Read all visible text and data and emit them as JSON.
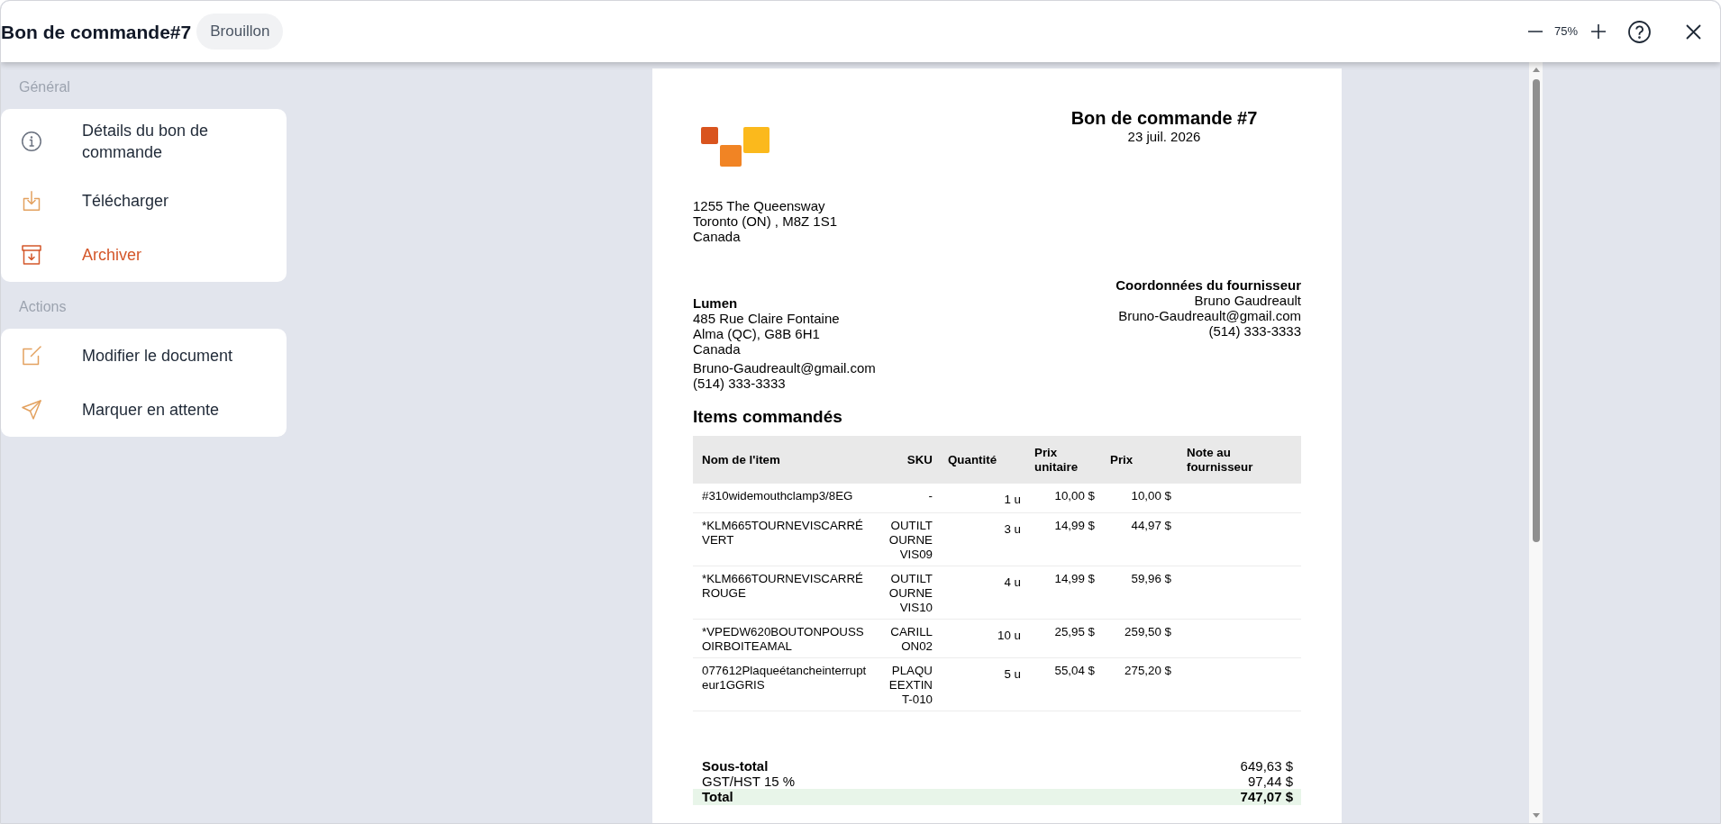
{
  "window": {
    "title": "Bon de commande#7",
    "status_badge": "Brouillon",
    "zoom_level": "75%"
  },
  "sidebar": {
    "sections": [
      {
        "heading": "Général",
        "items": [
          {
            "label": "Détails du bon de commande",
            "kind": "info",
            "danger": false
          },
          {
            "label": "Télécharger",
            "kind": "download",
            "danger": false
          },
          {
            "label": "Archiver",
            "kind": "archive",
            "danger": true
          }
        ]
      },
      {
        "heading": "Actions",
        "items": [
          {
            "label": "Modifier le document",
            "kind": "edit",
            "danger": false
          },
          {
            "label": "Marquer en attente",
            "kind": "send",
            "danger": false
          }
        ]
      }
    ]
  },
  "document": {
    "title": "Bon de commande #7",
    "date": "23 juil. 2026",
    "company_address": [
      "1255 The Queensway",
      "Toronto (ON) , M8Z 1S1",
      "Canada"
    ],
    "supplier": {
      "name": "Lumen",
      "address": [
        "485 Rue Claire Fontaine",
        "Alma (QC), G8B 6H1",
        "Canada"
      ],
      "email": "Bruno-Gaudreault@gmail.com",
      "phone": "(514) 333-3333"
    },
    "supplier_contact": {
      "heading": "Coordonnées du fournisseur",
      "name": "Bruno Gaudreault",
      "email": "Bruno-Gaudreault@gmail.com",
      "phone": "(514) 333-3333"
    },
    "items_heading": "Items commandés",
    "table": {
      "columns": [
        "Nom de l'item",
        "SKU",
        "Quantité",
        "Prix unitaire",
        "Prix",
        "Note au fournisseur"
      ],
      "rows": [
        {
          "name": "#310widemouthclamp3/8EG",
          "sku": "-",
          "quantity": "1 u",
          "unit_price": "10,00 $",
          "price": "10,00 $"
        },
        {
          "name": "*KLM665TOURNEVISCARRÉ VERT",
          "sku": "OUTILTOURNEVIS09",
          "quantity": "3 u",
          "unit_price": "14,99 $",
          "price": "44,97 $"
        },
        {
          "name": "*KLM666TOURNEVISCARRÉ ROUGE",
          "sku": "OUTILTOURNEVIS10",
          "quantity": "4 u",
          "unit_price": "14,99 $",
          "price": "59,96 $"
        },
        {
          "name": "*VPEDW620BOUTONPOUSSOIRBOITEAMAL",
          "sku": "CARILLON02",
          "quantity": "10 u",
          "unit_price": "25,95 $",
          "price": "259,50 $"
        },
        {
          "name": "077612Plaqueétancheinterrupteur1GGRIS",
          "sku": "PLAQUEEXTINT-010",
          "quantity": "5 u",
          "unit_price": "55,04 $",
          "price": "275,20 $"
        }
      ]
    },
    "totals": [
      {
        "kind": "subtotal",
        "label": "Sous-total",
        "value": "649,63 $"
      },
      {
        "kind": "tax",
        "label": "GST/HST 15 %",
        "value": "97,44 $"
      },
      {
        "kind": "total",
        "label": "Total",
        "value": "747,07 $"
      }
    ]
  }
}
